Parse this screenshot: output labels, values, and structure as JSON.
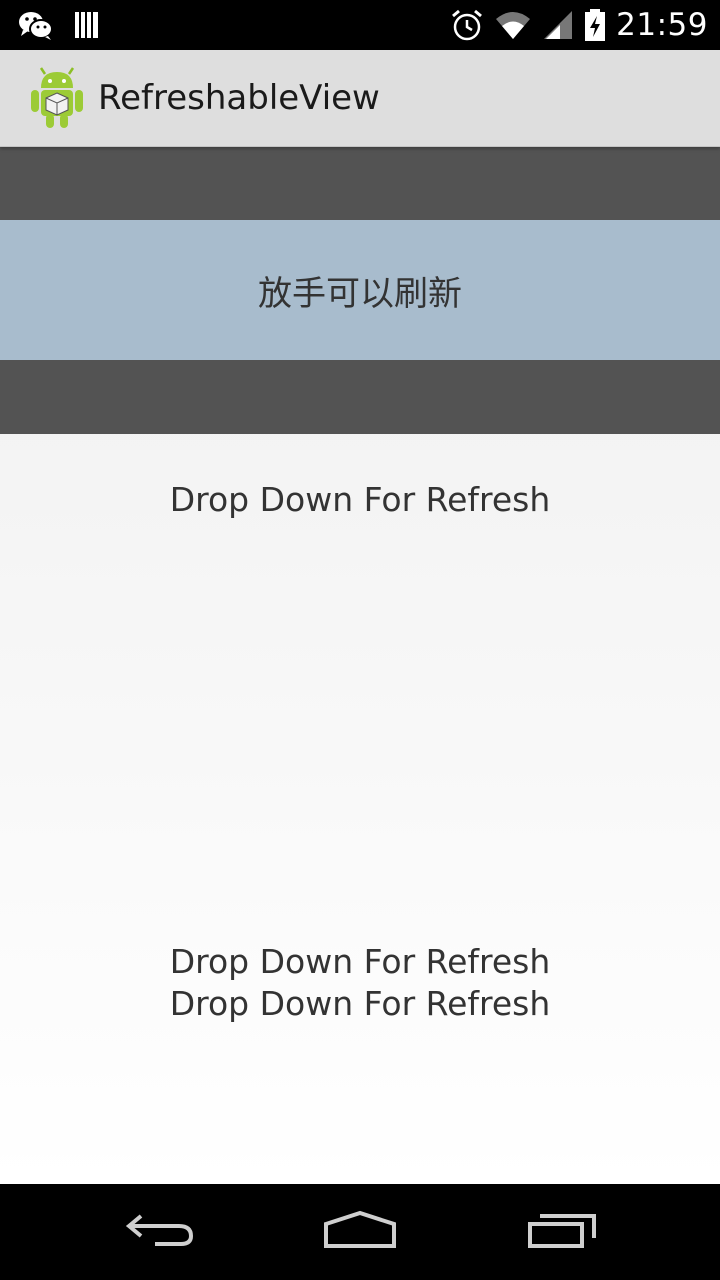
{
  "status_bar": {
    "time": "21:59",
    "left_icons": [
      "wechat-icon",
      "barcode-icon"
    ],
    "right_icons": [
      "alarm-icon",
      "wifi-icon",
      "signal-icon",
      "battery-charging-icon"
    ]
  },
  "action_bar": {
    "title": "RefreshableView",
    "icon": "android-app-icon"
  },
  "refresh_header": {
    "text": "放手可以刷新"
  },
  "list": {
    "items": [
      "Drop Down For Refresh",
      "Drop Down For Refresh",
      "Drop Down For Refresh"
    ]
  },
  "nav_bar": {
    "buttons": [
      "back-icon",
      "home-icon",
      "recent-apps-icon"
    ]
  },
  "colors": {
    "header_bg": "#a8bccd",
    "dark_band": "#535353",
    "action_bar_bg": "#dedede"
  }
}
